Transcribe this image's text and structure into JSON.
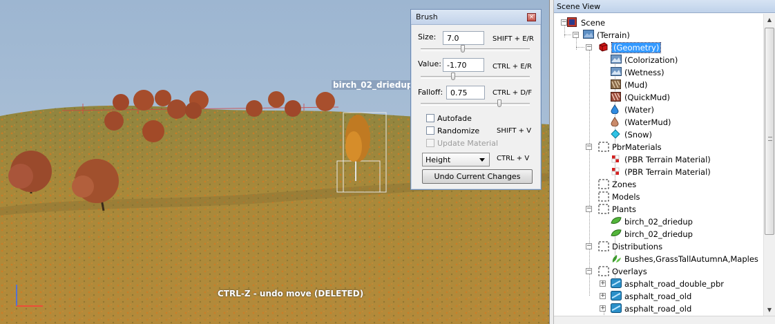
{
  "viewport": {
    "selected_label": "birch_02_driedup",
    "status_message": "CTRL-Z - undo move (DELETED)"
  },
  "brush": {
    "title": "Brush",
    "size_label": "Size:",
    "size_value": "7.0",
    "size_shortcut": "SHIFT + E/R",
    "size_slider": 0.38,
    "value_label": "Value:",
    "value_value": "-1.70",
    "value_shortcut": "CTRL + E/R",
    "value_slider": 0.29,
    "falloff_label": "Falloff:",
    "falloff_value": "0.75",
    "falloff_shortcut": "CTRL + D/F",
    "falloff_slider": 0.73,
    "autofade_label": "Autofade",
    "autofade_checked": false,
    "randomize_label": "Randomize",
    "randomize_checked": false,
    "randomize_shortcut": "SHIFT + V",
    "update_material_label": "Update Material",
    "update_material_checked": false,
    "mode_selected": "Height",
    "mode_shortcut": "CTRL + V",
    "undo_button": "Undo Current Changes"
  },
  "scene_view": {
    "title": "Scene View",
    "tree": [
      {
        "label": "Scene",
        "icon": "scene-icon",
        "level": 0,
        "expander": "-"
      },
      {
        "label": "(Terrain)",
        "icon": "terrain-icon",
        "level": 1,
        "expander": "-"
      },
      {
        "label": "(Geometry)",
        "icon": "geometry-icon",
        "level": 2,
        "expander": "-",
        "selected": true
      },
      {
        "label": "(Colorization)",
        "icon": "image-icon",
        "level": 3
      },
      {
        "label": "(Wetness)",
        "icon": "image-icon",
        "level": 3
      },
      {
        "label": "(Mud)",
        "icon": "mud-icon",
        "level": 3
      },
      {
        "label": "(QuickMud)",
        "icon": "quickmud-icon",
        "level": 3
      },
      {
        "label": "(Water)",
        "icon": "water-drop-icon",
        "level": 3
      },
      {
        "label": "(WaterMud)",
        "icon": "watermud-drop-icon",
        "level": 3
      },
      {
        "label": "(Snow)",
        "icon": "snow-diamond-icon",
        "level": 3
      },
      {
        "label": "PbrMaterials",
        "icon": "folder-icon",
        "level": 2,
        "expander": "-"
      },
      {
        "label": "(PBR Terrain Material)",
        "icon": "pbr-material-icon",
        "level": 3
      },
      {
        "label": "(PBR Terrain Material)",
        "icon": "pbr-material-icon",
        "level": 3
      },
      {
        "label": "Zones",
        "icon": "folder-icon",
        "level": 2
      },
      {
        "label": "Models",
        "icon": "folder-icon",
        "level": 2
      },
      {
        "label": "Plants",
        "icon": "folder-icon",
        "level": 2,
        "expander": "-"
      },
      {
        "label": "birch_02_driedup",
        "icon": "leaf-icon",
        "level": 3
      },
      {
        "label": "birch_02_driedup",
        "icon": "leaf-icon",
        "level": 3
      },
      {
        "label": "Distributions",
        "icon": "folder-icon",
        "level": 2,
        "expander": "-"
      },
      {
        "label": "Bushes,GrassTallAutumnA,Maples",
        "icon": "plants-icon",
        "level": 3
      },
      {
        "label": "Overlays",
        "icon": "folder-icon",
        "level": 2,
        "expander": "-"
      },
      {
        "label": "asphalt_road_double_pbr",
        "icon": "road-icon",
        "level": 3,
        "expander": "+"
      },
      {
        "label": "asphalt_road_old",
        "icon": "road-icon",
        "level": 3,
        "expander": "+"
      },
      {
        "label": "asphalt_road_old",
        "icon": "road-icon",
        "level": 3,
        "expander": "+"
      }
    ]
  },
  "colors": {
    "sky": "#a3bcd6",
    "terrain": "#a88a3a",
    "selection": "#3399ff",
    "tree_autumn": "#b0532c"
  }
}
